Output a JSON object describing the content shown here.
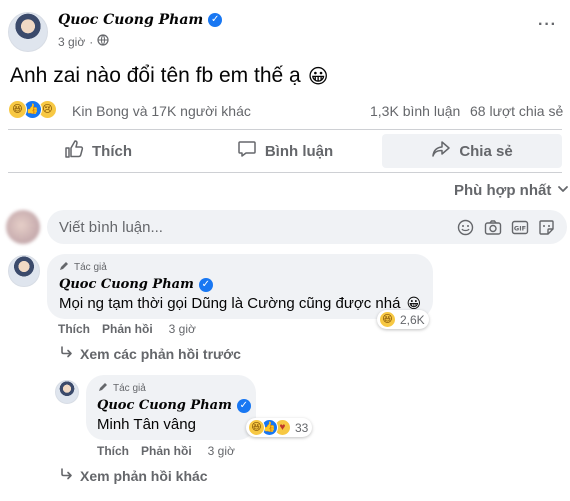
{
  "post": {
    "author": "Quoc Cuong Pham",
    "time": "3 giờ",
    "separator": "·",
    "menu_glyph": "···",
    "text": "Anh zai nào đổi tên fb em thế ạ",
    "text_emoji": "😀"
  },
  "stats": {
    "reactions_text": "Kin Bong và 17K người khác",
    "comments": "1,3K bình luận",
    "shares": "68 lượt chia sẻ",
    "reaction_icons": [
      "laugh-icon",
      "like-icon",
      "sad-icon"
    ]
  },
  "actions": {
    "like": "Thích",
    "comment": "Bình luận",
    "share": "Chia sẻ"
  },
  "sort": {
    "label": "Phù hợp nhất"
  },
  "composer": {
    "placeholder": "Viết bình luận..."
  },
  "comments": [
    {
      "tag": "Tác giả",
      "author": "Quoc Cuong Pham",
      "text": "Mọi ng tạm thời gọi Dũng là Cường cũng được nhá",
      "text_emoji": "😀",
      "like": "Thích",
      "reply": "Phản hồi",
      "time": "3 giờ",
      "reaction_count": "2,6K",
      "previous_replies": "Xem các phản hồi trước"
    },
    {
      "tag": "Tác giả",
      "author": "Quoc Cuong Pham",
      "text": "Minh Tân vâng",
      "like": "Thích",
      "reply": "Phản hồi",
      "time": "3 giờ",
      "reaction_count": "33",
      "more_replies": "Xem phản hồi khác"
    }
  ],
  "colors": {
    "verified": "#1877f2",
    "muted": "#65676b",
    "bubble": "#f0f2f5",
    "divider": "#ced0d4"
  }
}
